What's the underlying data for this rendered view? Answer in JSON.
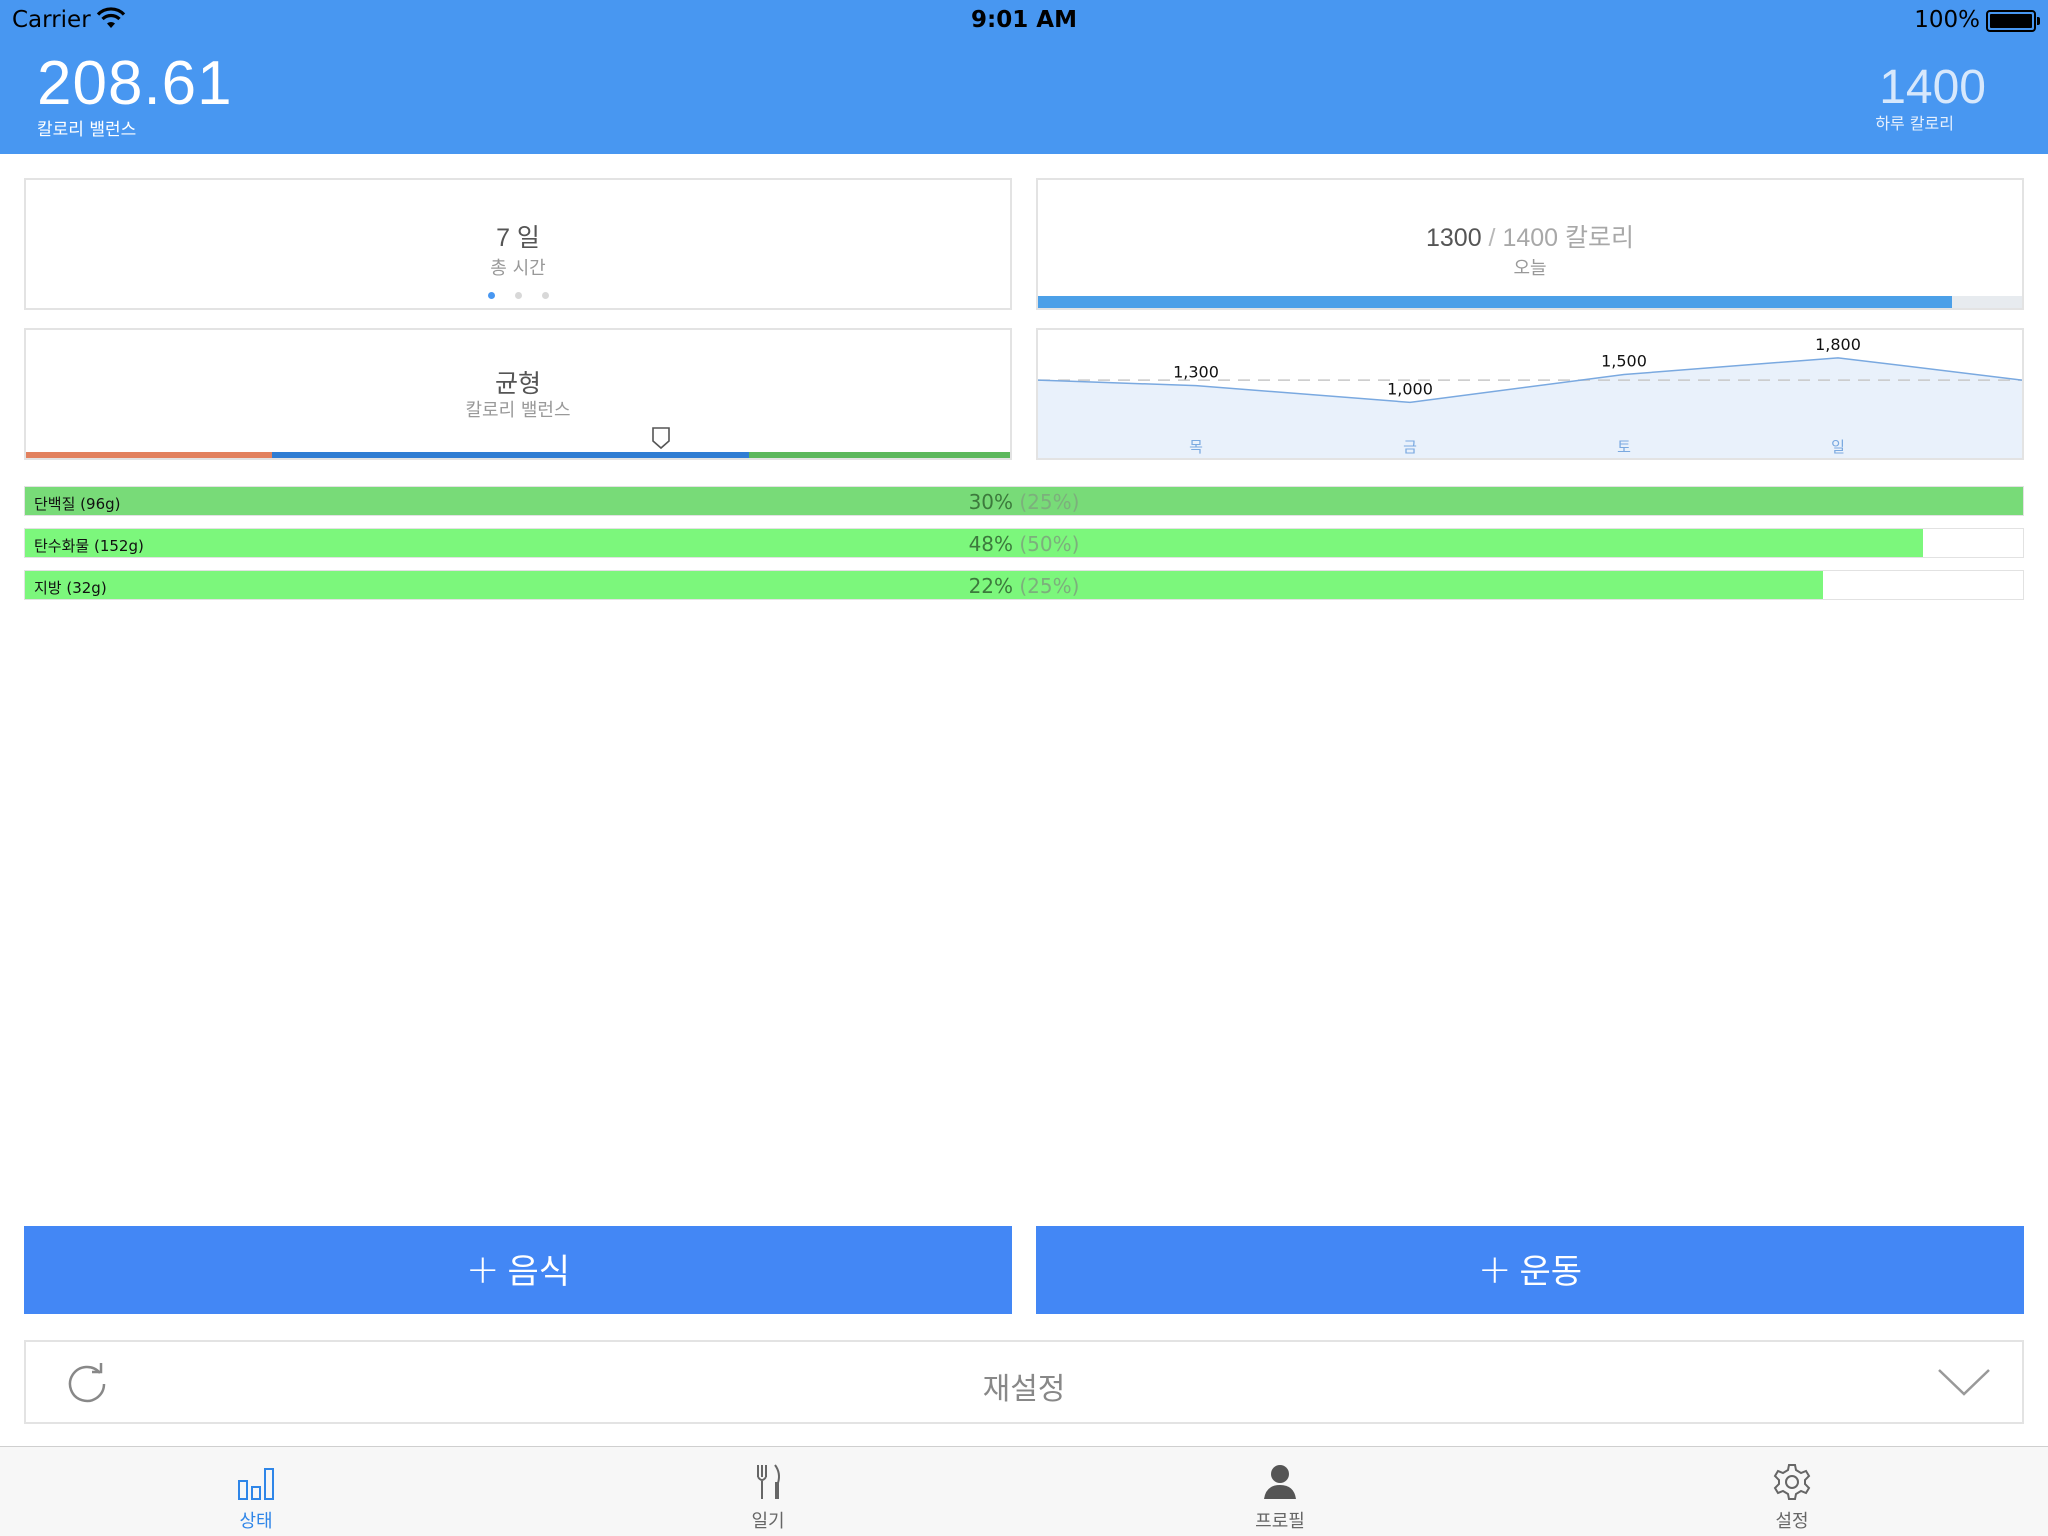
{
  "status_bar": {
    "carrier": "Carrier",
    "time": "9:01 AM",
    "battery": "100%"
  },
  "header": {
    "balance_value": "208.61",
    "balance_label": "칼로리 밸런스",
    "daily_value": "1400",
    "daily_label": "하루 칼로리"
  },
  "cards": {
    "days": {
      "title": "7 일",
      "subtitle": "총 시간",
      "page_count": 3,
      "active_page": 0
    },
    "today": {
      "consumed": "1300",
      "separator": " / ",
      "goal": "1400 칼로리",
      "subtitle": "오늘",
      "progress_fraction": 0.929
    },
    "balance": {
      "title": "균형",
      "subtitle": "칼로리 밸런스",
      "marker_fraction": 0.645
    }
  },
  "chart_data": {
    "type": "area",
    "categories": [
      "",
      "목",
      "금",
      "토",
      "일",
      ""
    ],
    "values": [
      1400,
      1300,
      1000,
      1500,
      1800,
      1400
    ],
    "data_labels": [
      "",
      "1,300",
      "1,000",
      "1,500",
      "1,800",
      ""
    ],
    "reference_line": 1400,
    "ylim": [
      0,
      2300
    ],
    "colors": {
      "line": "#7aa9e0",
      "fill": "#e9f1fb",
      "reference": "#c8c8c8",
      "tick": "#7aa9e0"
    }
  },
  "macros": [
    {
      "label": "단백질 (96g)",
      "percent": "30%",
      "target": "(25%)",
      "fill_fraction": 1.0,
      "color": "#78db78"
    },
    {
      "label": "탄수화물 (152g)",
      "percent": "48%",
      "target": "(50%)",
      "fill_fraction": 0.95,
      "color": "#7cf77c"
    },
    {
      "label": "지방 (32g)",
      "percent": "22%",
      "target": "(25%)",
      "fill_fraction": 0.9,
      "color": "#7cf77c"
    }
  ],
  "actions": {
    "food_plus": "+",
    "food_label": "음식",
    "exercise_plus": "+",
    "exercise_label": "운동",
    "reset_label": "재설정"
  },
  "tabs": [
    {
      "label": "상태",
      "icon": "bar-chart-icon",
      "active": true
    },
    {
      "label": "일기",
      "icon": "fork-knife-icon",
      "active": false
    },
    {
      "label": "프로필",
      "icon": "person-icon",
      "active": false
    },
    {
      "label": "설정",
      "icon": "gear-icon",
      "active": false
    }
  ],
  "colors": {
    "header": "#4897f1",
    "button": "#4387f5",
    "balance_segments": [
      "#e2815e",
      "#2f7dd3",
      "#5cb85c"
    ]
  }
}
